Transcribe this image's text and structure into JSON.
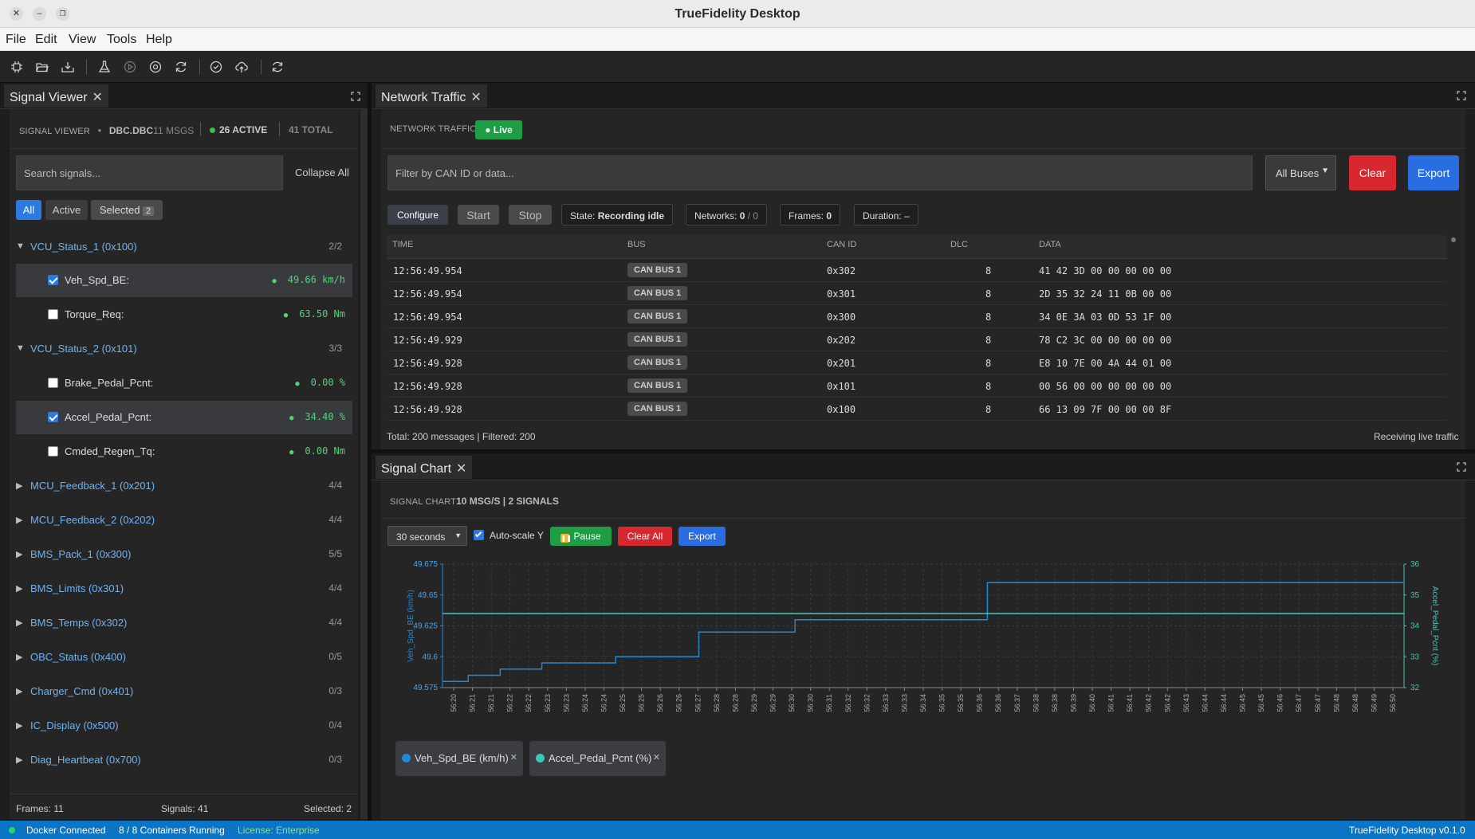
{
  "window": {
    "title": "TrueFidelity Desktop"
  },
  "menu": [
    "File",
    "Edit",
    "View",
    "Tools",
    "Help"
  ],
  "toolbar": {
    "icons": [
      "chip-icon",
      "folder-open-icon",
      "import-icon",
      "flask-icon",
      "play-circle-icon",
      "target-icon",
      "refresh-icon",
      "check-circle-icon",
      "cloud-upload-icon",
      "sync-icon"
    ]
  },
  "signal_viewer": {
    "tab_label": "Signal Viewer",
    "header_label": "SIGNAL VIEWER",
    "dbc_file": "DBC.DBC",
    "msgs": "11 MSGS",
    "active": "26 ACTIVE",
    "total": "41 TOTAL",
    "search_placeholder": "Search signals...",
    "collapse_all": "Collapse All",
    "filters": {
      "all": "All",
      "active": "Active",
      "selected": "Selected",
      "selected_count": "2"
    },
    "groups": [
      {
        "name": "VCU_Status_1 (0x100)",
        "count": "2/2",
        "expanded": true,
        "signals": [
          {
            "name": "Veh_Spd_BE:",
            "value": "49.66 km/h",
            "checked": true
          },
          {
            "name": "Torque_Req:",
            "value": "63.50 Nm",
            "checked": false
          }
        ]
      },
      {
        "name": "VCU_Status_2 (0x101)",
        "count": "3/3",
        "expanded": true,
        "signals": [
          {
            "name": "Brake_Pedal_Pcnt:",
            "value": "0.00 %",
            "checked": false
          },
          {
            "name": "Accel_Pedal_Pcnt:",
            "value": "34.40 %",
            "checked": true
          },
          {
            "name": "Cmded_Regen_Tq:",
            "value": "0.00 Nm",
            "checked": false
          }
        ]
      },
      {
        "name": "MCU_Feedback_1 (0x201)",
        "count": "4/4"
      },
      {
        "name": "MCU_Feedback_2 (0x202)",
        "count": "4/4"
      },
      {
        "name": "BMS_Pack_1 (0x300)",
        "count": "5/5"
      },
      {
        "name": "BMS_Limits (0x301)",
        "count": "4/4"
      },
      {
        "name": "BMS_Temps (0x302)",
        "count": "4/4"
      },
      {
        "name": "OBC_Status (0x400)",
        "count": "0/5"
      },
      {
        "name": "Charger_Cmd (0x401)",
        "count": "0/3"
      },
      {
        "name": "IC_Display (0x500)",
        "count": "0/4"
      },
      {
        "name": "Diag_Heartbeat (0x700)",
        "count": "0/3"
      }
    ],
    "footer": {
      "frames": "Frames: 11",
      "signals": "Signals: 41",
      "selected": "Selected: 2"
    }
  },
  "network_traffic": {
    "tab_label": "Network Traffic",
    "header_label": "NETWORK TRAFFIC",
    "live_badge": "● Live",
    "filter_placeholder": "Filter by CAN ID or data...",
    "bus_select": "All Buses",
    "clear": "Clear",
    "export": "Export",
    "configure": "Configure",
    "start": "Start",
    "stop": "Stop",
    "state_label": "State:",
    "state_value": "Recording idle",
    "networks_label": "Networks:",
    "networks_value": "0",
    "networks_total": "/ 0",
    "frames_label": "Frames:",
    "frames_value": "0",
    "duration_label": "Duration:",
    "duration_value": "–",
    "columns": [
      "TIME",
      "BUS",
      "CAN ID",
      "DLC",
      "DATA"
    ],
    "rows": [
      {
        "time": "12:56:49.954",
        "bus": "CAN BUS 1",
        "id": "0x302",
        "dlc": "8",
        "data": "41 42 3D 00 00 00 00 00"
      },
      {
        "time": "12:56:49.954",
        "bus": "CAN BUS 1",
        "id": "0x301",
        "dlc": "8",
        "data": "2D 35 32 24 11 0B 00 00"
      },
      {
        "time": "12:56:49.954",
        "bus": "CAN BUS 1",
        "id": "0x300",
        "dlc": "8",
        "data": "34 0E 3A 03 0D 53 1F 00"
      },
      {
        "time": "12:56:49.929",
        "bus": "CAN BUS 1",
        "id": "0x202",
        "dlc": "8",
        "data": "78 C2 3C 00 00 00 00 00"
      },
      {
        "time": "12:56:49.928",
        "bus": "CAN BUS 1",
        "id": "0x201",
        "dlc": "8",
        "data": "E8 10 7E 00 4A 44 01 00"
      },
      {
        "time": "12:56:49.928",
        "bus": "CAN BUS 1",
        "id": "0x101",
        "dlc": "8",
        "data": "00 56 00 00 00 00 00 00"
      },
      {
        "time": "12:56:49.928",
        "bus": "CAN BUS 1",
        "id": "0x100",
        "dlc": "8",
        "data": "66 13 09 7F 00 00 00 8F"
      }
    ],
    "footer_total": "Total: 200 messages | Filtered: 200",
    "footer_status": "Receiving live traffic"
  },
  "signal_chart": {
    "tab_label": "Signal Chart",
    "header_label": "SIGNAL CHART",
    "rate_info": "10 MSG/S | 2 SIGNALS",
    "window_select": "30 seconds",
    "autoscale": "Auto-scale Y",
    "pause": "Pause",
    "clear_all": "Clear All",
    "export": "Export",
    "legend": [
      {
        "label": "Veh_Spd_BE (km/h)",
        "color": "#1f8ad6"
      },
      {
        "label": "Accel_Pedal_Pcnt (%)",
        "color": "#3cc8b4"
      }
    ]
  },
  "chart_data": {
    "type": "line",
    "xlabel": "",
    "ylabel": "Veh_Spd_BE (km/h)",
    "y2label": "Accel_Pedal_Pcnt (%)",
    "ylim": [
      49.575,
      49.675
    ],
    "y2lim": [
      32,
      36
    ],
    "yticks": [
      "49.675",
      "49.65",
      "49.625",
      "49.6",
      "49.575"
    ],
    "y2ticks": [
      "36",
      "35",
      "34",
      "33",
      "32"
    ],
    "x_ticks": [
      "56:20",
      "56:21",
      "56:21",
      "56:22",
      "56:22",
      "56:23",
      "56:23",
      "56:24",
      "56:24",
      "56:25",
      "56:25",
      "56:26",
      "56:26",
      "56:27",
      "56:28",
      "56:28",
      "56:29",
      "56:29",
      "56:30",
      "56:30",
      "56:31",
      "56:32",
      "56:32",
      "56:33",
      "56:33",
      "56:34",
      "56:35",
      "56:35",
      "56:36",
      "56:36",
      "56:37",
      "56:38",
      "56:38",
      "56:39",
      "56:40",
      "56:41",
      "56:41",
      "56:42",
      "56:42",
      "56:43",
      "56:44",
      "56:44",
      "56:45",
      "56:45",
      "56:46",
      "56:47",
      "56:47",
      "56:48",
      "56:48",
      "56:49",
      "56:50"
    ],
    "x_range_s": [
      0,
      30
    ],
    "grid": true,
    "series": [
      {
        "name": "Veh_Spd_BE (km/h)",
        "axis": "left",
        "color": "#1f8ad6",
        "x": [
          0,
          0.8,
          1.8,
          3.1,
          5.4,
          8,
          11,
          17,
          30
        ],
        "values": [
          49.58,
          49.585,
          49.59,
          49.595,
          49.6,
          49.62,
          49.63,
          49.66,
          49.66
        ]
      },
      {
        "name": "Accel_Pedal_Pcnt (%)",
        "axis": "right",
        "color": "#3cc8b4",
        "x": [
          0,
          30
        ],
        "values": [
          34.4,
          34.4
        ]
      }
    ]
  },
  "statusbar": {
    "docker": "Docker Connected",
    "containers": "8 / 8 Containers Running",
    "license": "License: Enterprise",
    "version": "TrueFidelity Desktop v0.1.0"
  }
}
